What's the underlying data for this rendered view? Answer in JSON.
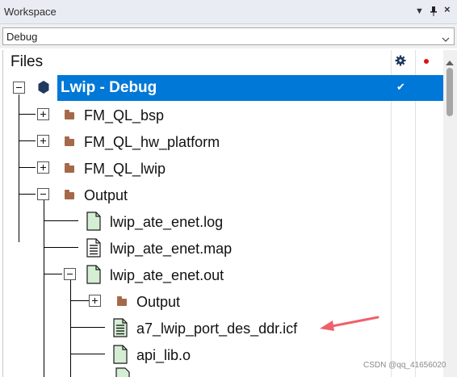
{
  "titlebar": {
    "title": "Workspace"
  },
  "config": {
    "selected": "Debug"
  },
  "files": {
    "header": "Files",
    "project": "Lwip - Debug",
    "items": [
      {
        "label": "FM_QL_bsp"
      },
      {
        "label": "FM_QL_hw_platform"
      },
      {
        "label": "FM_QL_lwip"
      },
      {
        "label": "Output"
      },
      {
        "label": "lwip_ate_enet.log"
      },
      {
        "label": "lwip_ate_enet.map"
      },
      {
        "label": "lwip_ate_enet.out"
      },
      {
        "label": "Output"
      },
      {
        "label": "a7_lwip_port_des_ddr.icf"
      },
      {
        "label": "api_lib.o"
      }
    ]
  },
  "watermark": "CSDN @qq_41656020",
  "colors": {
    "selection": "#0078d7",
    "annotation_arrow": "#f0606a",
    "folder": "#a5694a",
    "file_green": "#d4eed4"
  }
}
